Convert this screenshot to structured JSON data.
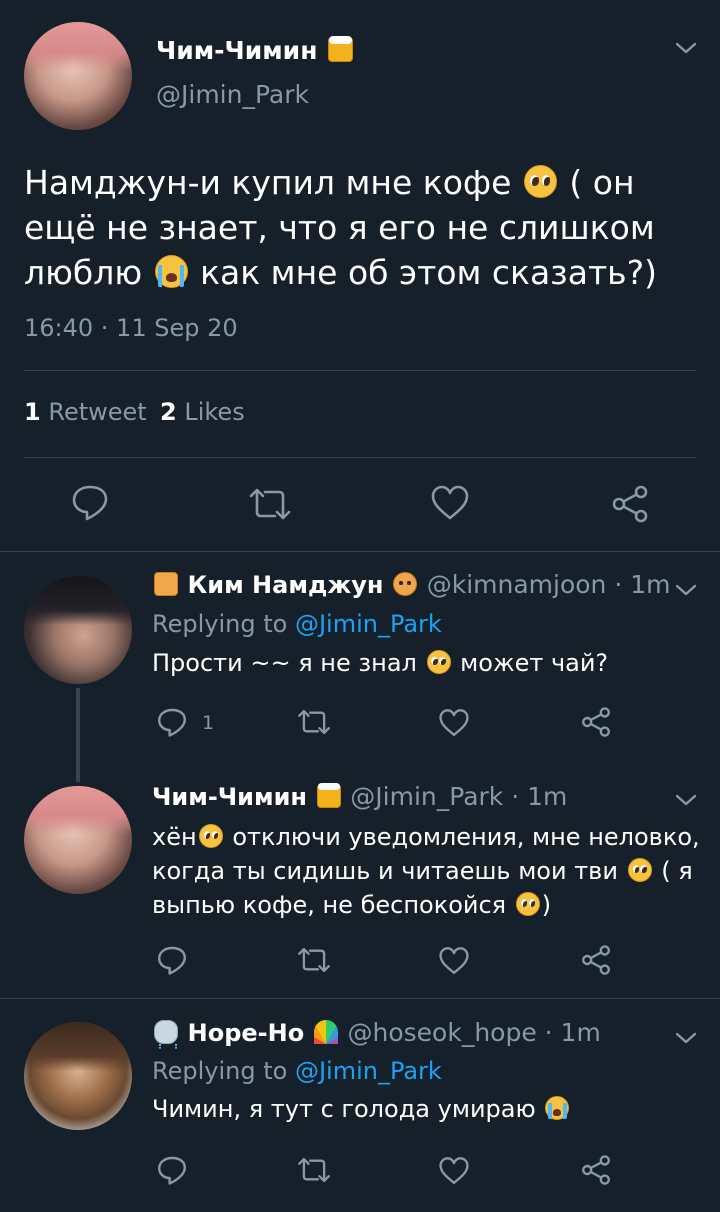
{
  "main_tweet": {
    "author_name": "Чим-Чимин",
    "author_handle": "@Jimin_Park",
    "text_part1": "Намджун-и купил мне кофе",
    "text_part2": "( он ещё не знает, что я его не слишком",
    "text_part3": "люблю",
    "text_part4": "как мне об этом сказать?)",
    "timestamp": "16:40 · 11 Sep 20",
    "retweet_count": "1",
    "retweet_label": "Retweet",
    "like_count": "2",
    "like_label": "Likes"
  },
  "replies": [
    {
      "author_name": "Ким Намджун",
      "author_handle": "@kimnamjoon · 1m",
      "replying_label": "Replying to",
      "replying_to": "@Jimin_Park",
      "text_a": "Прости ~~ я не знал",
      "text_b": "может чай?",
      "reply_count": "1"
    },
    {
      "author_name": "Чим-Чимин",
      "author_handle": "@Jimin_Park · 1m",
      "line1a": "хён",
      "line1b": "отключи уведомления, мне неловко,",
      "line2a": "когда ты сидишь и читаешь мои тви",
      "line2b": "( я",
      "line3a": "выпью кофе, не беспокойся",
      "line3b": ")"
    },
    {
      "author_name": "Hope-Ho",
      "author_handle": "@hoseok_hope · 1m",
      "replying_label": "Replying to",
      "replying_to": "@Jimin_Park",
      "text_a": "Чимин, я тут с голода умираю"
    }
  ],
  "icons": {
    "chevron": "chevron-down-icon",
    "reply": "reply-icon",
    "retweet": "retweet-icon",
    "like": "heart-icon",
    "share": "share-icon"
  },
  "colors": {
    "background": "#15202b",
    "muted": "#8899a6",
    "link": "#1da1f2",
    "divider": "#38444d"
  }
}
